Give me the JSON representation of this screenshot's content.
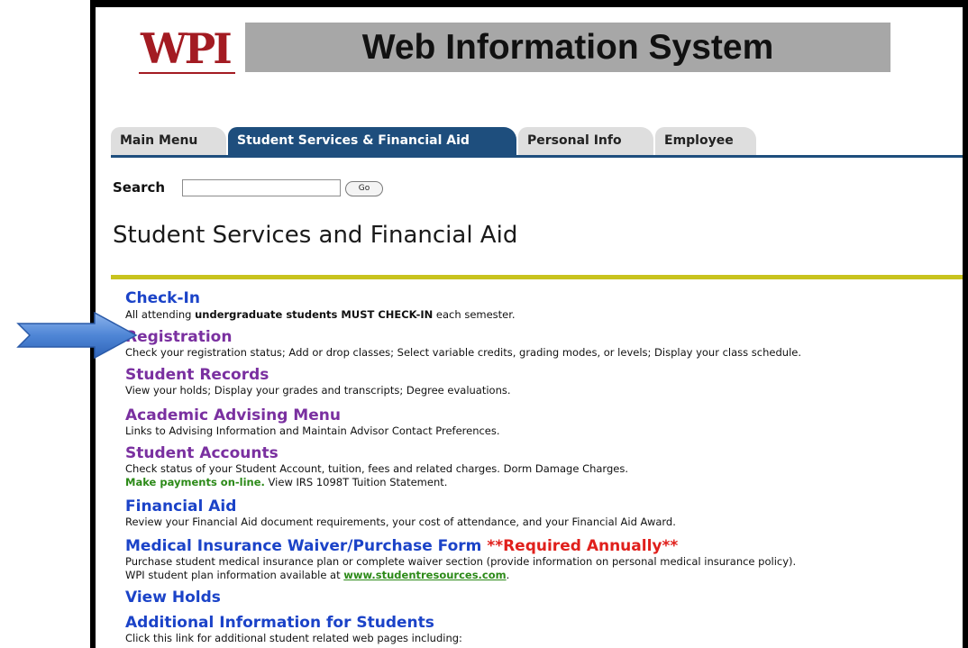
{
  "header": {
    "logo_text": "WPI",
    "title": "Web Information System"
  },
  "tabs": [
    {
      "label": "Main Menu",
      "active": false
    },
    {
      "label": "Student Services & Financial Aid",
      "active": true
    },
    {
      "label": "Personal Info",
      "active": false
    },
    {
      "label": "Employee",
      "active": false
    }
  ],
  "search": {
    "label": "Search",
    "value": "",
    "go_label": "Go"
  },
  "page_title": "Student Services and Financial Aid",
  "menu": {
    "checkin": {
      "title": "Check-In",
      "desc_a": "All attending ",
      "desc_b": "undergraduate students MUST CHECK-IN",
      "desc_c": " each semester."
    },
    "registration": {
      "title": "Registration",
      "desc": "Check your registration status; Add or drop classes; Select variable credits, grading modes, or levels; Display your class schedule."
    },
    "records": {
      "title": "Student Records",
      "desc": "View your holds; Display your grades and transcripts; Degree evaluations."
    },
    "advising": {
      "title": "Academic Advising Menu",
      "desc": "Links to Advising Information and Maintain Advisor Contact Preferences."
    },
    "accounts": {
      "title": "Student Accounts",
      "desc": "Check status of your Student Account, tuition, fees and related charges. Dorm Damage Charges.",
      "pay_link": "Make payments on-line.",
      "desc2": " View IRS 1098T Tuition Statement."
    },
    "finaid": {
      "title": "Financial Aid",
      "desc": "Review your Financial Aid document requirements, your cost of attendance, and your Financial Aid Award."
    },
    "insurance": {
      "title": "Medical Insurance Waiver/Purchase Form",
      "required": "**Required Annually**",
      "desc": "Purchase student medical insurance plan or complete waiver section (provide information on personal medical insurance policy).",
      "desc2": "WPI student plan information available at ",
      "link": "www.studentresources.com",
      "desc2_end": "."
    },
    "holds": {
      "title": "View Holds"
    },
    "additional": {
      "title": "Additional Information for Students",
      "desc": "Click this link for additional student related web pages including:"
    }
  },
  "colors": {
    "tab_active": "#1e4e7d",
    "link": "#1b43c8",
    "visited": "#7a30a0",
    "rule_yellow": "#c8c31e",
    "logo_red": "#a31b22",
    "arrow": "#4f86d6"
  },
  "icons": {
    "arrow": "right-arrow-icon"
  }
}
